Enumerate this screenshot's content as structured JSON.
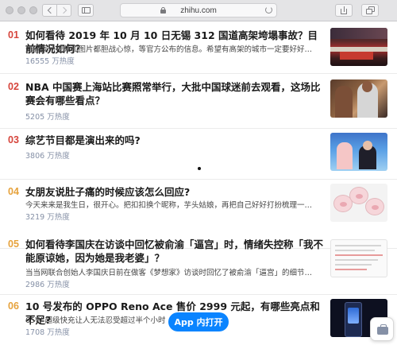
{
  "browser": {
    "url": "zhihu.com"
  },
  "colors": {
    "rank_top": "#d6453c",
    "rank_other": "#e6a23c",
    "accent": "#0a84ff",
    "heat": "#8590a6"
  },
  "hotlist": [
    {
      "rank": "01",
      "title": "如何看待 2019 年 10 月 10 日无锡 312 国道高架垮塌事故？目前情况如何？",
      "excerpt": "光看现场视频和图片都胆战心惊，等官方公布的信息。希望有高架的城市一定要好好…",
      "heat": "16555 万热度"
    },
    {
      "rank": "02",
      "title": "NBA 中国赛上海站比赛照常举行，大批中国球迷前去观看，这场比赛会有哪些看点？",
      "excerpt": "",
      "heat": "5205 万热度"
    },
    {
      "rank": "03",
      "title": "综艺节目都是演出来的吗?",
      "excerpt": "",
      "heat": "3806 万热度"
    },
    {
      "rank": "04",
      "title": "女朋友说肚子痛的时候应该怎么回应?",
      "excerpt": "今天来来是我生日，很开心。把扣扣换个昵称，芋头姑娘，再把自己好好打扮梳理一…",
      "heat": "3219 万热度"
    },
    {
      "rank": "05",
      "title": "如何看待李国庆在访谈中回忆被俞渝「逼宫」时，情绪失控称「我不能原谅她，因为她是我老婆」？",
      "excerpt": "当当网联合创始人李国庆日前在做客《梦想家》访谈时回忆了被俞渝「逼宫」的细节…",
      "heat": "2986 万热度"
    },
    {
      "rank": "06",
      "title": "10 号发布的 OPPO Reno Ace 售价 2999 元起，有哪些亮点和不足?",
      "excerpt": "65W 超级快充让人无法忍受超过半个小时",
      "heat": "1708 万热度"
    }
  ],
  "buttons": {
    "open_app": "App 内打开"
  },
  "icons": [
    "back-icon",
    "forward-icon",
    "sidebar-icon",
    "lock-icon",
    "reload-icon",
    "share-icon",
    "tabs-icon",
    "briefcase-icon"
  ]
}
